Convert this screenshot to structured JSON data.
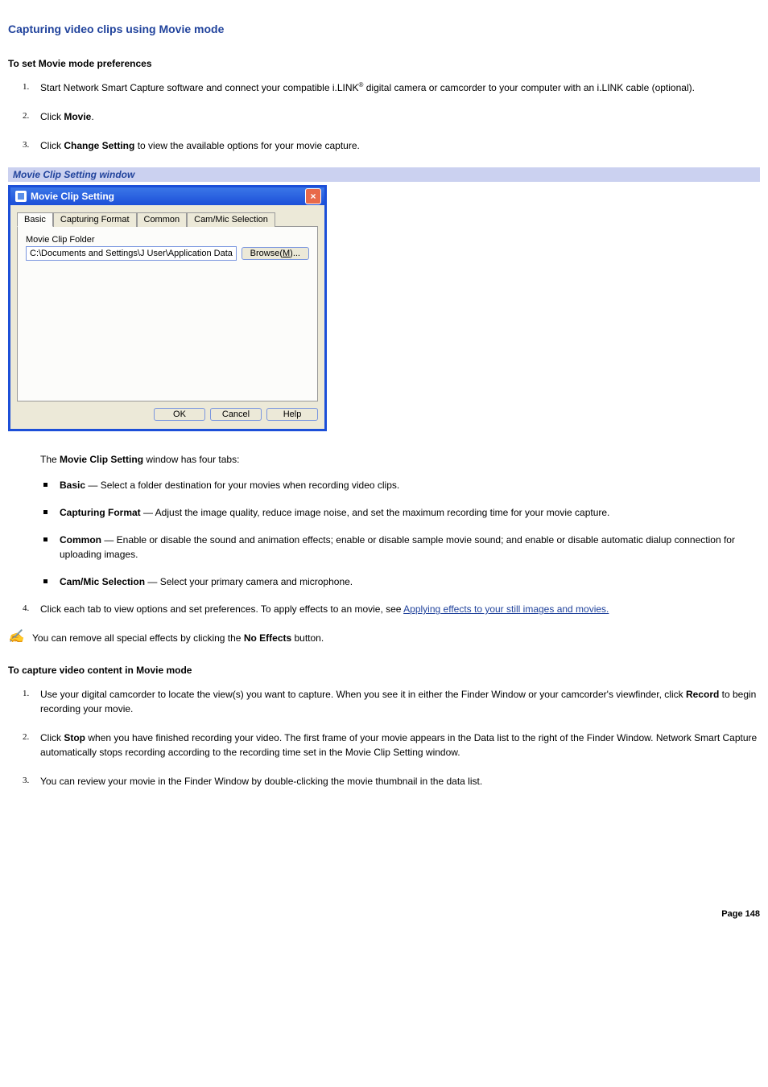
{
  "page": {
    "title": "Capturing video clips using Movie mode",
    "heading_set_prefs": "To set Movie mode preferences",
    "steps_set_prefs": [
      {
        "num": "1.",
        "pre": "Start Network Smart Capture software and connect your compatible i.LINK",
        "reg": "®",
        "post": " digital camera or camcorder to your computer with an i.LINK cable (optional)."
      },
      {
        "num": "2.",
        "pre": "Click ",
        "bold": "Movie",
        "post": "."
      },
      {
        "num": "3.",
        "pre": "Click ",
        "bold": "Change Setting",
        "post": " to view the available options for your movie capture."
      }
    ],
    "caption": "Movie Clip Setting window",
    "tabs_intro_pre": "The ",
    "tabs_intro_bold": "Movie Clip Setting",
    "tabs_intro_post": " window has four tabs:",
    "tab_descriptions": [
      {
        "name": "Basic",
        "desc": " — Select a folder destination for your movies when recording video clips."
      },
      {
        "name": "Capturing Format",
        "desc": " — Adjust the image quality, reduce image noise, and set the maximum recording time for your movie capture."
      },
      {
        "name": "Common",
        "desc": " — Enable or disable the sound and animation effects; enable or disable sample movie sound; and enable or disable automatic dialup connection for uploading images."
      },
      {
        "name": "Cam/Mic Selection",
        "desc": " — Select your primary camera and microphone."
      }
    ],
    "step4": {
      "num": "4.",
      "pre": "Click each tab to view options and set preferences. To apply effects to an movie, see ",
      "link": "Applying effects to your still images and movies."
    },
    "note_pre": "You can remove all special effects by clicking the ",
    "note_bold": "No Effects",
    "note_post": " button.",
    "heading_capture": "To capture video content in Movie mode",
    "steps_capture": [
      {
        "num": "1.",
        "pre": "Use your digital camcorder to locate the view(s) you want to capture. When you see it in either the Finder Window or your camcorder's viewfinder, click ",
        "bold": "Record",
        "post": " to begin recording your movie."
      },
      {
        "num": "2.",
        "pre": "Click ",
        "bold": "Stop",
        "post": " when you have finished recording your video. The first frame of your movie appears in the Data list to the right of the Finder Window. Network Smart Capture automatically stops recording according to the recording time set in the Movie Clip Setting window."
      },
      {
        "num": "3.",
        "pre": "You can review your movie in the Finder Window by double-clicking the movie thumbnail in the data list.",
        "bold": "",
        "post": ""
      }
    ],
    "page_number": "Page 148"
  },
  "dialog": {
    "title": "Movie Clip Setting",
    "close": "×",
    "tabs": [
      "Basic",
      "Capturing Format",
      "Common",
      "Cam/Mic Selection"
    ],
    "active_tab_index": 0,
    "folder_label": "Movie Clip Folder",
    "folder_value": "C:\\Documents and Settings\\J User\\Application Data\\So",
    "browse_pre": "Browse(",
    "browse_mnemonic": "M",
    "browse_post": ")...",
    "buttons": {
      "ok": "OK",
      "cancel": "Cancel",
      "help": "Help"
    }
  }
}
